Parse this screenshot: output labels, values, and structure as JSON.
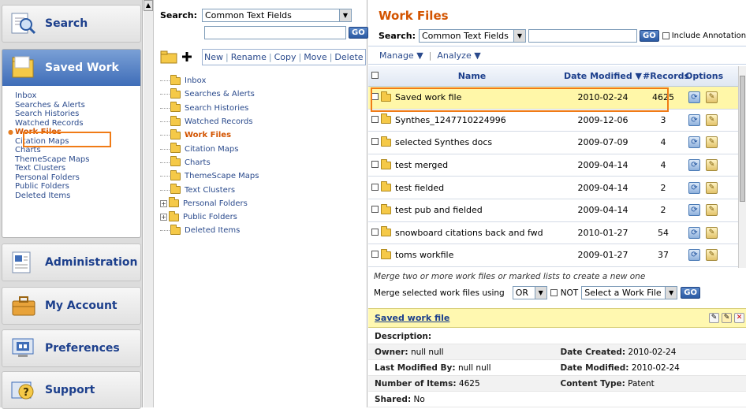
{
  "nav": {
    "search_label": "Search",
    "saved_work_label": "Saved Work",
    "saved_items": [
      "Inbox",
      "Searches & Alerts",
      "Search Histories",
      "Watched Records",
      "Work Files",
      "Citation Maps",
      "Charts",
      "ThemeScape Maps",
      "Text Clusters",
      "Personal Folders",
      "Public Folders",
      "Deleted Items"
    ],
    "selected_item": "Work Files",
    "administration_label": "Administration",
    "my_account_label": "My Account",
    "preferences_label": "Preferences",
    "support_label": "Support"
  },
  "folder_panel": {
    "search_label": "Search:",
    "search_scope": "Common Text Fields",
    "go_label": "GO",
    "actions": [
      "New",
      "Rename",
      "Copy",
      "Move",
      "Delete"
    ],
    "tree": [
      "Inbox",
      "Searches & Alerts",
      "Search Histories",
      "Watched Records",
      "Work Files",
      "Citation Maps",
      "Charts",
      "ThemeScape Maps",
      "Text Clusters",
      "Personal Folders",
      "Public Folders",
      "Deleted Items"
    ]
  },
  "main": {
    "title": "Work Files",
    "search_label": "Search:",
    "search_scope": "Common Text Fields",
    "go_label": "GO",
    "include_annotations": "Include Annotations",
    "manage_label": "Manage ▼",
    "analyze_label": "Analyze ▼",
    "columns": {
      "name": "Name",
      "date": "Date Modified ▼",
      "records": "#Records",
      "options": "Options"
    },
    "rows": [
      {
        "name": "Saved work file",
        "date": "2010-02-24",
        "records": "4625"
      },
      {
        "name": "Synthes_1247710224996",
        "date": "2009-12-06",
        "records": "3"
      },
      {
        "name": "selected Synthes docs",
        "date": "2009-07-09",
        "records": "4"
      },
      {
        "name": "test merged",
        "date": "2009-04-14",
        "records": "4"
      },
      {
        "name": "test fielded",
        "date": "2009-04-14",
        "records": "2"
      },
      {
        "name": "test pub and fielded",
        "date": "2009-04-14",
        "records": "2"
      },
      {
        "name": "snowboard citations back and fwd",
        "date": "2010-01-27",
        "records": "54"
      },
      {
        "name": "toms workfile",
        "date": "2009-01-27",
        "records": "37"
      }
    ],
    "merge_note": "Merge two or more work files or marked lists to create a new one",
    "merge_label": "Merge selected work files using",
    "merge_op": "OR",
    "not_label": "NOT",
    "merge_select": "Select a Work File",
    "detail": {
      "title": "Saved work file",
      "description_label": "Description:",
      "owner_label": "Owner:",
      "owner": "null null",
      "created_label": "Date Created:",
      "created": "2010-02-24",
      "modified_by_label": "Last Modified By:",
      "modified_by": "null null",
      "modified_label": "Date Modified:",
      "modified": "2010-02-24",
      "items_label": "Number of Items:",
      "items": "4625",
      "content_label": "Content Type:",
      "content": "Patent",
      "shared_label": "Shared:",
      "shared": "No"
    }
  },
  "colors": {
    "accent_orange": "#d35400",
    "highlight_box": "#f07b16",
    "link_blue": "#1c3f8c",
    "row_highlight": "#fff7a8"
  }
}
